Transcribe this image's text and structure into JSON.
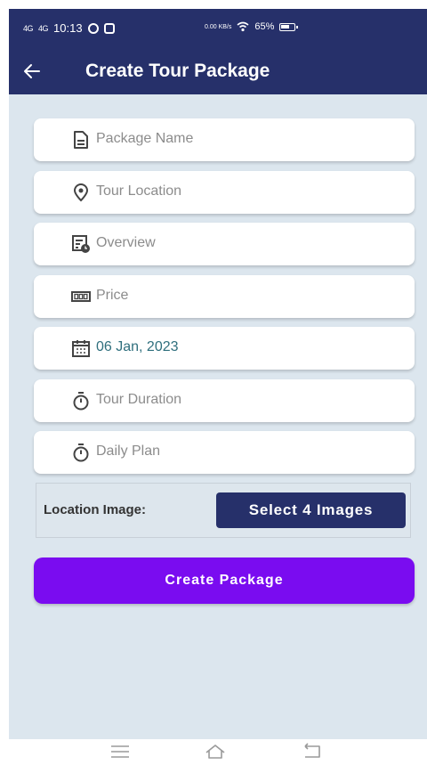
{
  "status_bar": {
    "network1": "4G",
    "network2": "4G",
    "time": "10:13",
    "speed": "0.00 KB/s",
    "battery": "65%"
  },
  "app_bar": {
    "title": "Create Tour Package",
    "back_icon": "arrow-left-icon"
  },
  "form": {
    "fields": [
      {
        "icon": "document-icon",
        "placeholder": "Package Name",
        "value": ""
      },
      {
        "icon": "location-pin-icon",
        "placeholder": "Tour Location",
        "value": ""
      },
      {
        "icon": "overview-clock-icon",
        "placeholder": "Overview",
        "value": ""
      },
      {
        "icon": "price-counter-icon",
        "placeholder": "Price",
        "value": ""
      },
      {
        "icon": "calendar-icon",
        "placeholder": "",
        "value": "06 Jan, 2023"
      },
      {
        "icon": "timer-icon",
        "placeholder": "Tour Duration",
        "value": ""
      },
      {
        "icon": "timer-icon",
        "placeholder": "Daily Plan",
        "value": ""
      }
    ],
    "location_image_label": "Location Image:",
    "select_images_label": "Select 4 Images",
    "create_button_label": "Create Package"
  },
  "colors": {
    "primary": "#26306a",
    "accent": "#7a0cf0",
    "background": "#dce6ee",
    "date_text": "#2f6f7d"
  },
  "nav_bar": {
    "icons": [
      "menu-icon",
      "home-icon",
      "back-nav-icon"
    ]
  }
}
